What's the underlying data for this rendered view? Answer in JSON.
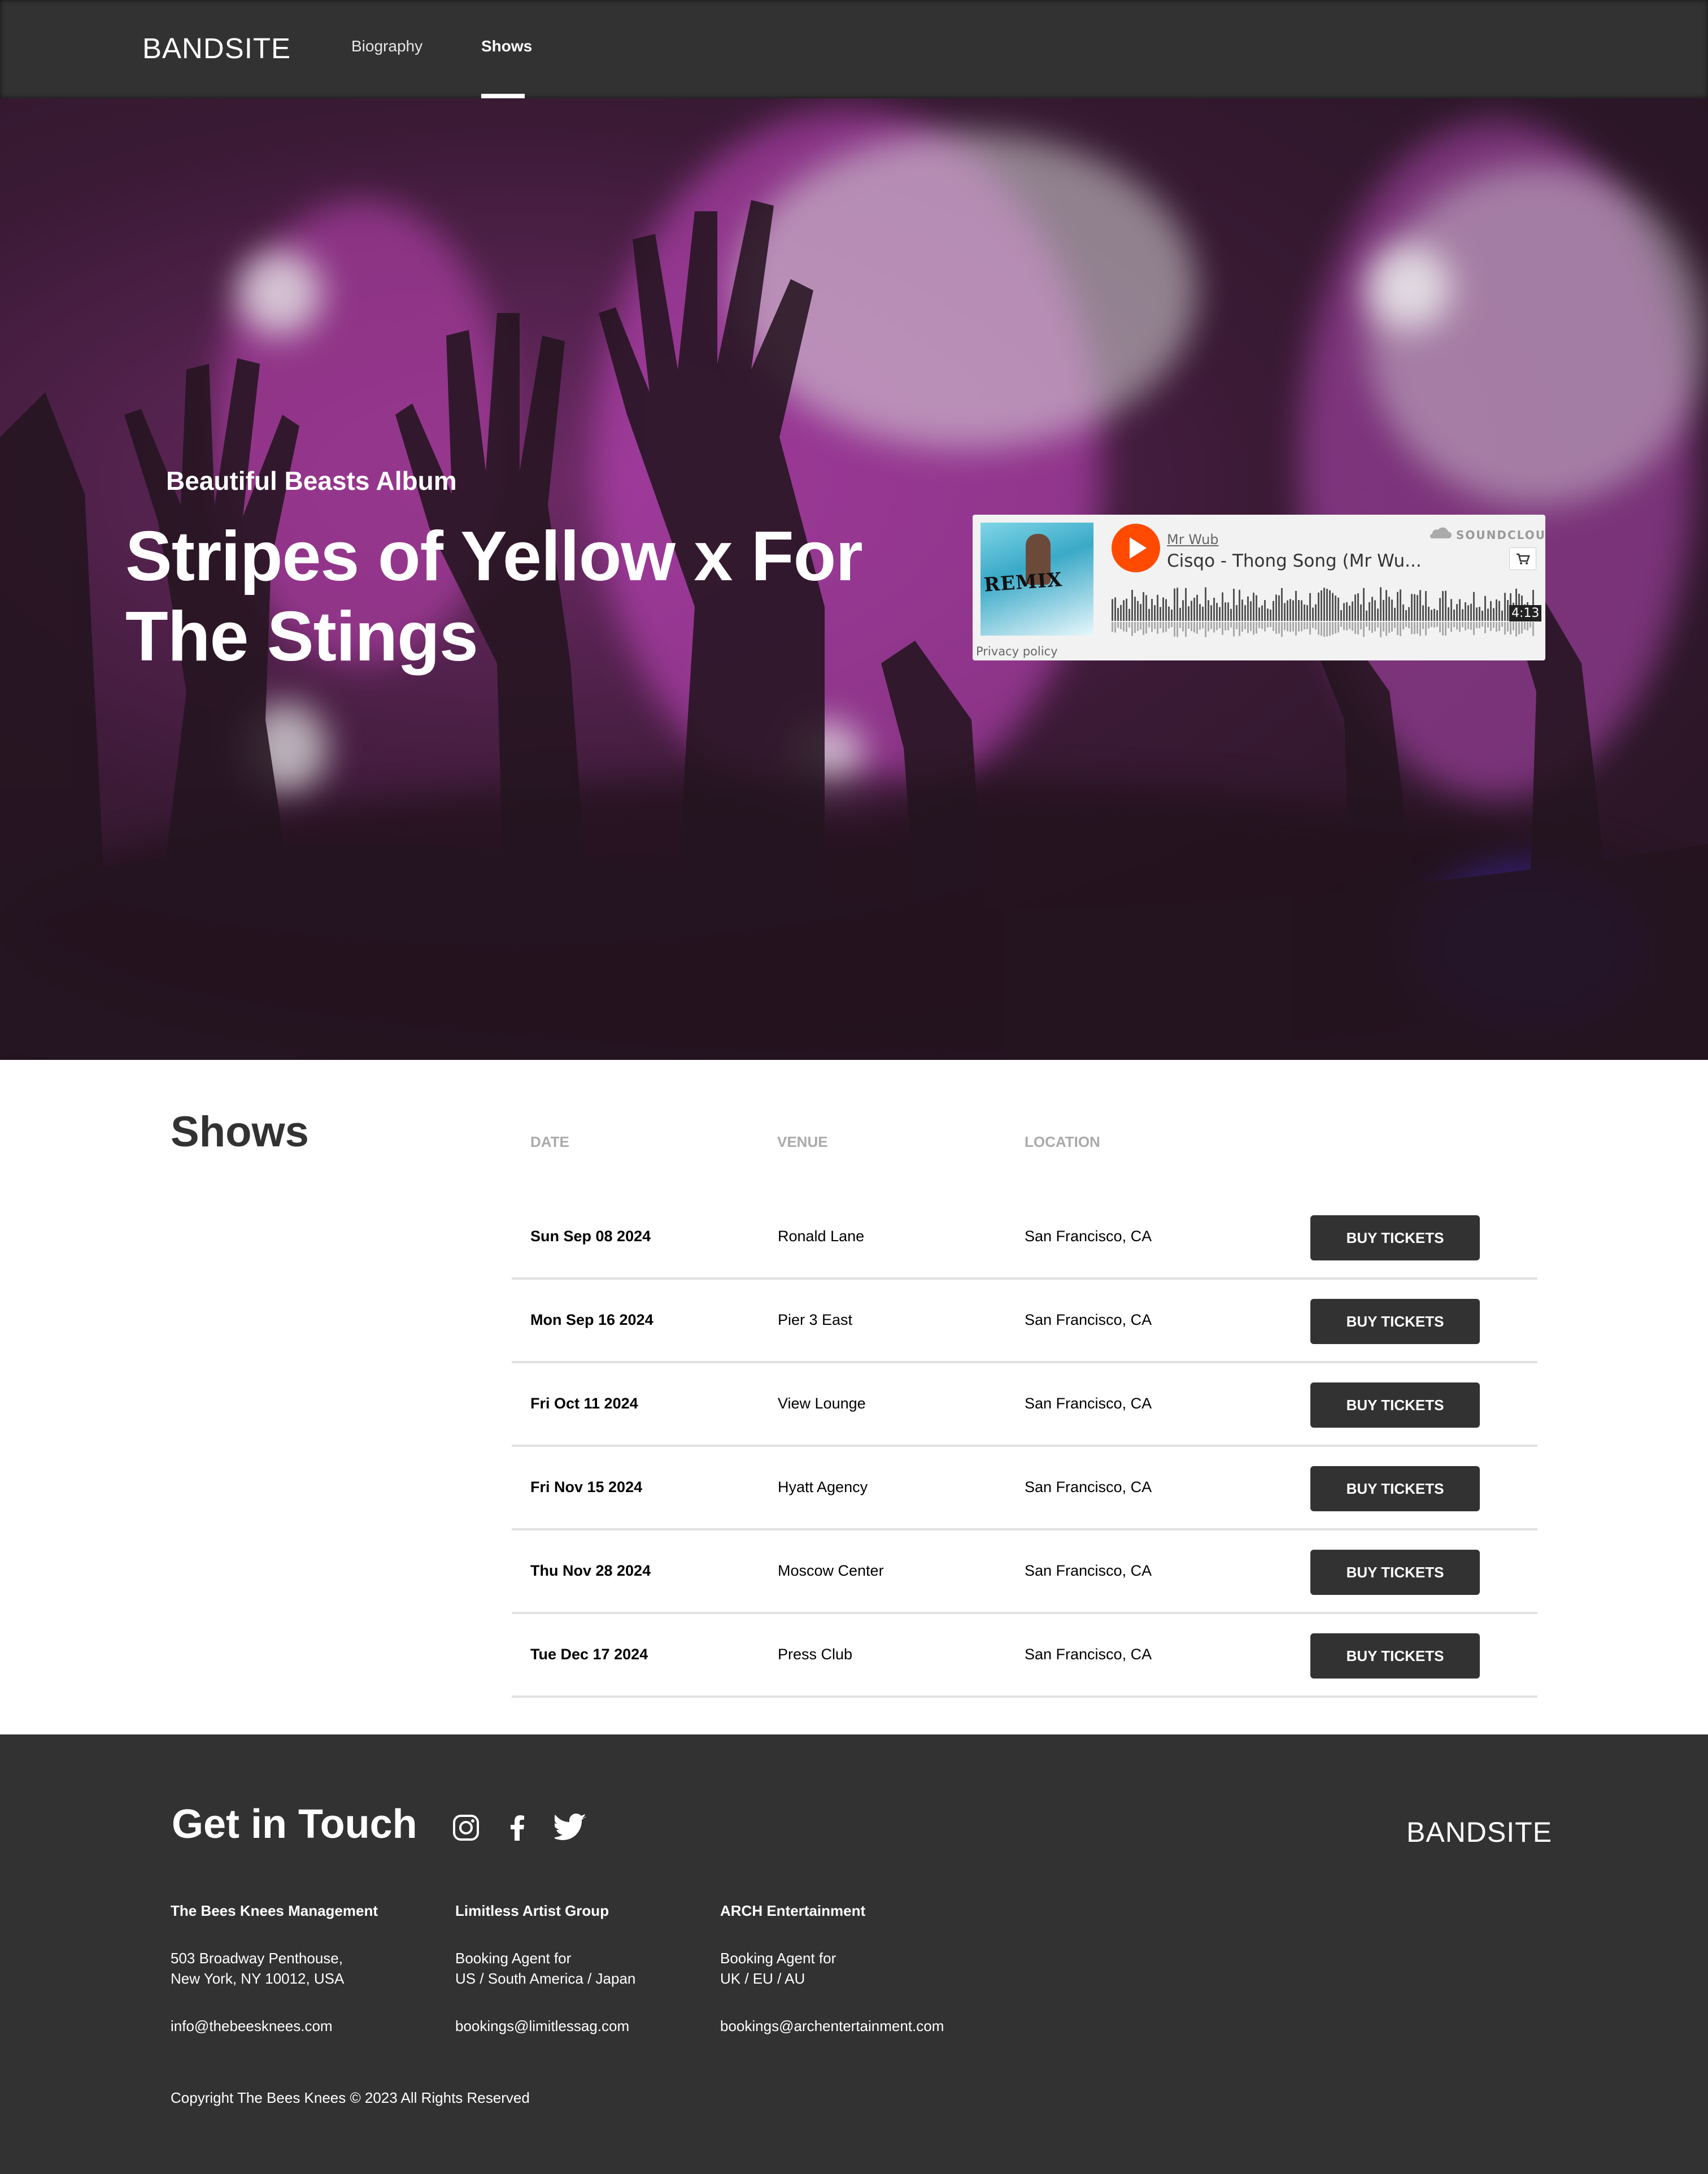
{
  "nav": {
    "logo": "BANDSITE",
    "links": [
      {
        "label": "Biography",
        "active": false
      },
      {
        "label": "Shows",
        "active": true
      }
    ]
  },
  "hero": {
    "subtitle": "Beautiful Beasts Album",
    "title": "Stripes of Yellow x For The Stings"
  },
  "player": {
    "artist": "Mr Wub",
    "track": "Cisqo - Thong Song (Mr Wu...",
    "brand": "SOUNDCLOUD",
    "duration": "4:13",
    "privacy": "Privacy policy",
    "artwork_text": "REMIX",
    "accent": "#ff4a00"
  },
  "shows": {
    "title": "Shows",
    "headers": {
      "date": "DATE",
      "venue": "VENUE",
      "location": "LOCATION"
    },
    "button_label": "BUY TICKETS",
    "rows": [
      {
        "date": "Sun Sep 08 2024",
        "venue": "Ronald Lane",
        "location": "San Francisco, CA"
      },
      {
        "date": "Mon Sep 16 2024",
        "venue": "Pier 3 East",
        "location": "San Francisco, CA"
      },
      {
        "date": "Fri Oct 11 2024",
        "venue": "View Lounge",
        "location": "San Francisco, CA"
      },
      {
        "date": "Fri Nov 15 2024",
        "venue": "Hyatt Agency",
        "location": "San Francisco, CA"
      },
      {
        "date": "Thu Nov 28 2024",
        "venue": "Moscow Center",
        "location": "San Francisco, CA"
      },
      {
        "date": "Tue Dec 17 2024",
        "venue": "Press Club",
        "location": "San Francisco, CA"
      }
    ]
  },
  "footer": {
    "title": "Get in Touch",
    "logo": "BANDSITE",
    "social_icons": [
      "instagram-icon",
      "facebook-icon",
      "twitter-icon"
    ],
    "contacts": [
      {
        "name": "The Bees Knees Management",
        "line1": "503 Broadway Penthouse,",
        "line2": "New York, NY 10012, USA",
        "email": "info@thebeesknees.com"
      },
      {
        "name": "Limitless Artist Group",
        "line1": "Booking Agent for",
        "line2": "US / South America / Japan",
        "email": "bookings@limitlessag.com"
      },
      {
        "name": "ARCH Entertainment",
        "line1": "Booking Agent for",
        "line2": "UK / EU / AU",
        "email": "bookings@archentertainment.com"
      }
    ],
    "copyright": "Copyright The Bees Knees © 2023 All Rights Reserved"
  },
  "colors": {
    "dark": "#323232",
    "white": "#ffffff",
    "divider": "#e1e1e1",
    "header_gray": "#aaaaaa"
  }
}
